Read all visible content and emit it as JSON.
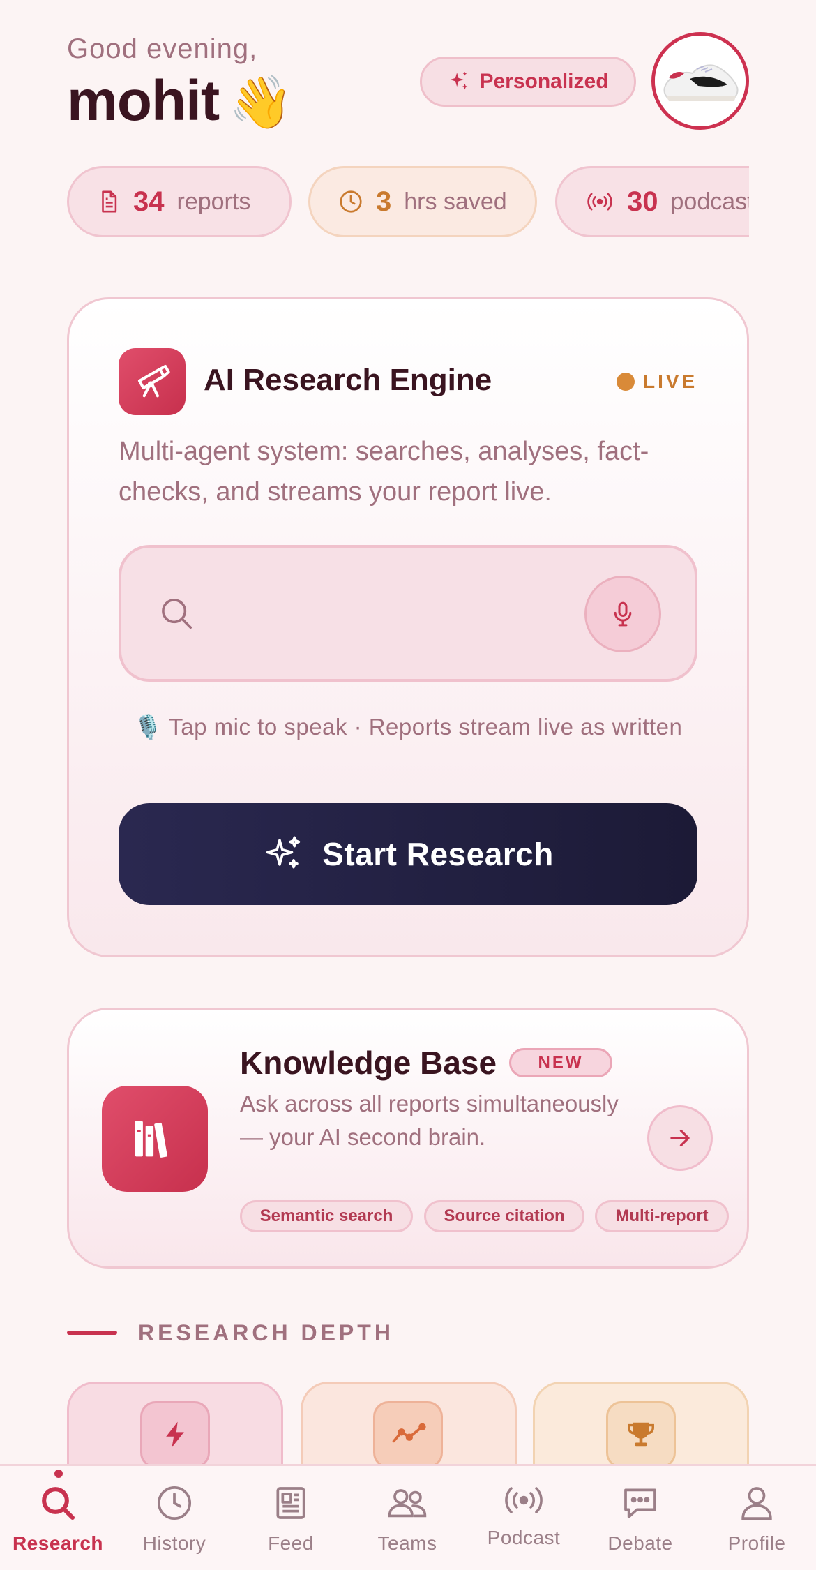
{
  "header": {
    "greeting": "Good evening,",
    "username": "mohit",
    "wave_emoji": "👋",
    "personalized_label": "Personalized"
  },
  "stats": [
    {
      "value": "34",
      "label": "reports",
      "icon": "document-icon"
    },
    {
      "value": "3",
      "label": "hrs saved",
      "icon": "clock-icon"
    },
    {
      "value": "30",
      "label": "podcasts",
      "icon": "broadcast-icon"
    }
  ],
  "engine": {
    "title": "AI Research Engine",
    "live_label": "LIVE",
    "description": "Multi-agent system: searches, analyses, fact-checks, and streams your report live.",
    "search_placeholder": "",
    "hint": "🎙️ Tap mic to speak  ·  Reports stream live as written",
    "start_label": "Start Research"
  },
  "knowledge_base": {
    "title": "Knowledge Base",
    "badge": "NEW",
    "description": "Ask across all reports simultaneously — your AI second brain.",
    "tags": [
      "Semantic search",
      "Source citation",
      "Multi-report"
    ]
  },
  "research_depth": {
    "title": "RESEARCH DEPTH",
    "options": [
      {
        "icon": "lightning-icon"
      },
      {
        "icon": "trend-line-icon"
      },
      {
        "icon": "trophy-icon"
      }
    ]
  },
  "nav": {
    "active": "Research",
    "items": [
      {
        "label": "Research",
        "icon": "search-icon"
      },
      {
        "label": "History",
        "icon": "clock-icon"
      },
      {
        "label": "Feed",
        "icon": "newspaper-icon"
      },
      {
        "label": "Teams",
        "icon": "users-icon"
      },
      {
        "label": "Podcast",
        "icon": "broadcast-icon"
      },
      {
        "label": "Debate",
        "icon": "chat-icon"
      },
      {
        "label": "Profile",
        "icon": "user-icon"
      }
    ]
  },
  "colors": {
    "background": "#fcf4f4",
    "accent": "#c8324f",
    "amber": "#c97a2e",
    "dark_button": "#22203f",
    "muted_text": "#a0707e"
  }
}
